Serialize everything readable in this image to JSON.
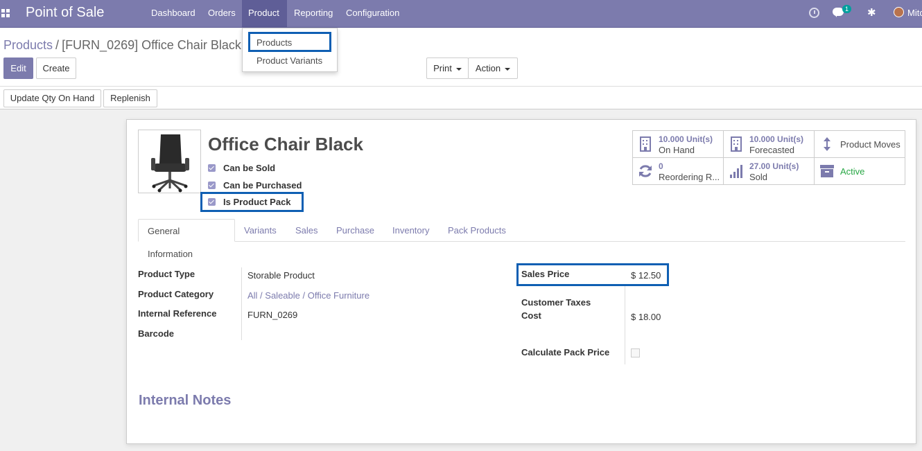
{
  "navbar": {
    "app_title": "Point of Sale",
    "menu": [
      "Dashboard",
      "Orders",
      "Product",
      "Reporting",
      "Configuration"
    ],
    "active_menu": "Product",
    "chat_badge": "1",
    "user_name": "Mitc"
  },
  "product_dropdown": {
    "items": [
      "Products",
      "Product Variants"
    ]
  },
  "breadcrumb": {
    "parent": "Products",
    "separator": "/",
    "current": "[FURN_0269] Office Chair Black"
  },
  "buttons": {
    "edit": "Edit",
    "create": "Create",
    "print": "Print",
    "action": "Action",
    "update_qty": "Update Qty On Hand",
    "replenish": "Replenish"
  },
  "product": {
    "name": "Office Chair Black",
    "checks": [
      "Can be Sold",
      "Can be Purchased",
      "Is Product Pack"
    ]
  },
  "smart_buttons": {
    "on_hand_value": "10.000 Unit(s)",
    "on_hand_label": "On Hand",
    "forecasted_value": "10.000 Unit(s)",
    "forecasted_label": "Forecasted",
    "product_moves": "Product Moves",
    "reordering_value": "0",
    "reordering_label": "Reordering R...",
    "sold_value": "27.00 Unit(s)",
    "sold_label": "Sold",
    "active_label": "Active"
  },
  "tabs": [
    "General Information",
    "Variants",
    "Sales",
    "Purchase",
    "Inventory",
    "Pack Products"
  ],
  "general": {
    "product_type_label": "Product Type",
    "product_type": "Storable Product",
    "product_category_label": "Product Category",
    "product_category": "All / Saleable / Office Furniture",
    "internal_reference_label": "Internal Reference",
    "internal_reference": "FURN_0269",
    "barcode_label": "Barcode",
    "sales_price_label": "Sales Price",
    "sales_price": "$ 12.50",
    "customer_taxes_label": "Customer Taxes",
    "cost_label": "Cost",
    "cost": "$ 18.00",
    "calc_pack_price_label": "Calculate Pack Price"
  },
  "internal_notes_title": "Internal Notes",
  "colors": {
    "brand": "#7c7bad",
    "highlight": "#0f5fb3",
    "active_green": "#28a745"
  }
}
